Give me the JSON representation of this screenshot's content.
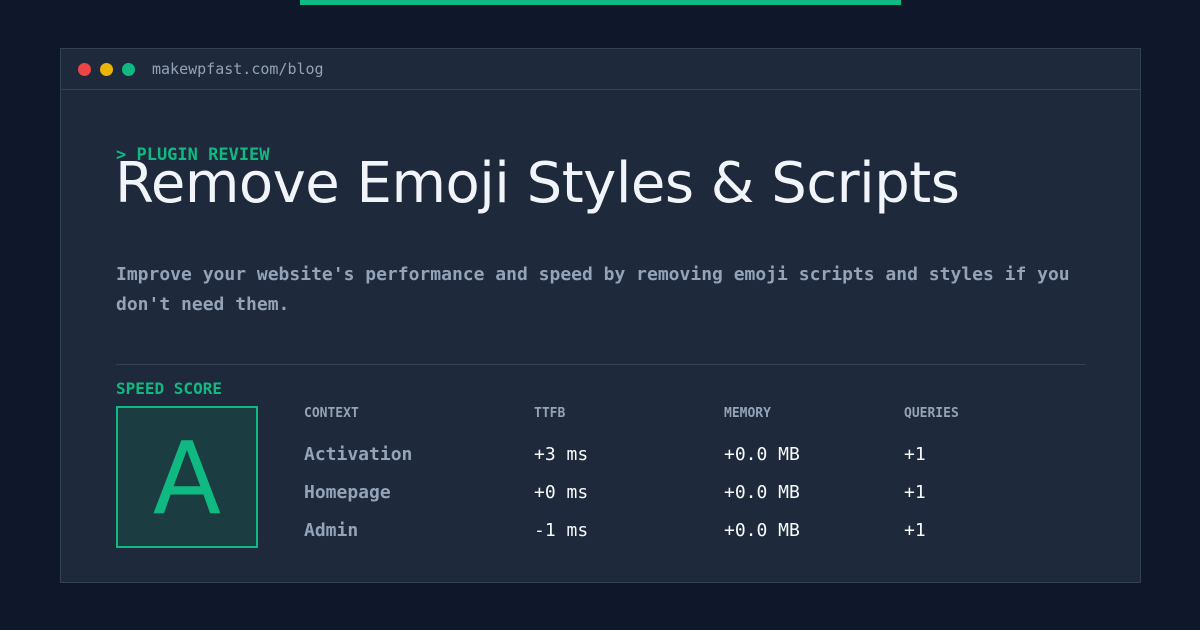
{
  "browser": {
    "url": "makewpfast.com/blog",
    "controls": {
      "close_color": "#ef4444",
      "minimize_color": "#eab308",
      "maximize_color": "#10b981"
    }
  },
  "article": {
    "eyebrow": "> PLUGIN REVIEW",
    "title": "Remove Emoji Styles & Scripts",
    "description": "Improve your website's performance and speed by removing emoji scripts and styles if you don't need them."
  },
  "score": {
    "label": "SPEED SCORE",
    "grade": "A"
  },
  "metrics": {
    "headers": [
      "CONTEXT",
      "TTFB",
      "MEMORY",
      "QUERIES"
    ],
    "rows": [
      [
        "Activation",
        "+3 ms",
        "+0.0 MB",
        "+1"
      ],
      [
        "Homepage",
        "+0 ms",
        "+0.0 MB",
        "+1"
      ],
      [
        "Admin",
        "-1 ms",
        "+0.0 MB",
        "+1"
      ]
    ]
  },
  "colors": {
    "accent": "#10b981",
    "background": "#0f172a",
    "panel": "#1e293b",
    "muted_text": "#94a3b8"
  }
}
